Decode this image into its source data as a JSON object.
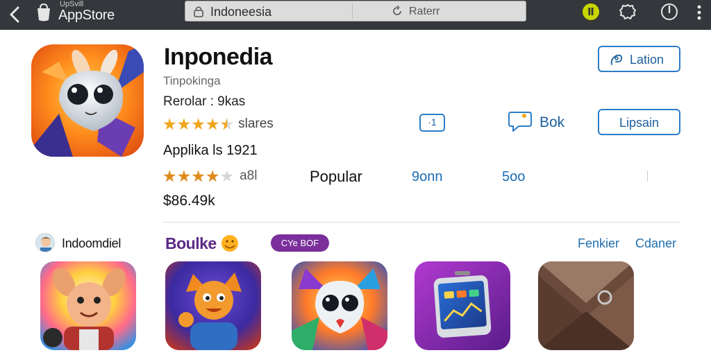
{
  "topbar": {
    "store_sub": "UpSvill",
    "store_name": "AppStore",
    "search_text": "Indoneesia",
    "refresh_label": "Raterr",
    "badge_glyph": "Ⅱ",
    "icons": [
      "back-icon",
      "app-store-logo",
      "lock-icon",
      "refresh-icon",
      "badge-icon",
      "settings-icon",
      "power-icon",
      "kebab-menu-icon"
    ]
  },
  "app": {
    "title": "Inponedia",
    "subtitle": "Tinpokinga",
    "line1": "Rerolar : 9kas",
    "rating": {
      "filled": 4.5,
      "max": 5,
      "label": "slares"
    },
    "line2": "Applika ls 1921",
    "rating2": {
      "filled": 4,
      "max": 5,
      "label": "a8l"
    },
    "popular_label": "Popular",
    "stat_a": "9onn",
    "stat_b": "5oo",
    "price": "$86.49k",
    "primary_button": "Lation",
    "share_button": "·1",
    "chat_label": "Bok",
    "secondary_button": "Lipsain"
  },
  "section": {
    "title": "Indoomdiel",
    "brand": "Boulke",
    "pill": "CYe BOF",
    "link_a": "Fenkier",
    "link_b": "Cdaner"
  },
  "colors": {
    "topbar_bg": "#34373b",
    "accent_blue": "#2a7cc7",
    "star": "#f2a51c",
    "brand_purple": "#5b2a86",
    "pill_purple": "#7a2f9b"
  }
}
